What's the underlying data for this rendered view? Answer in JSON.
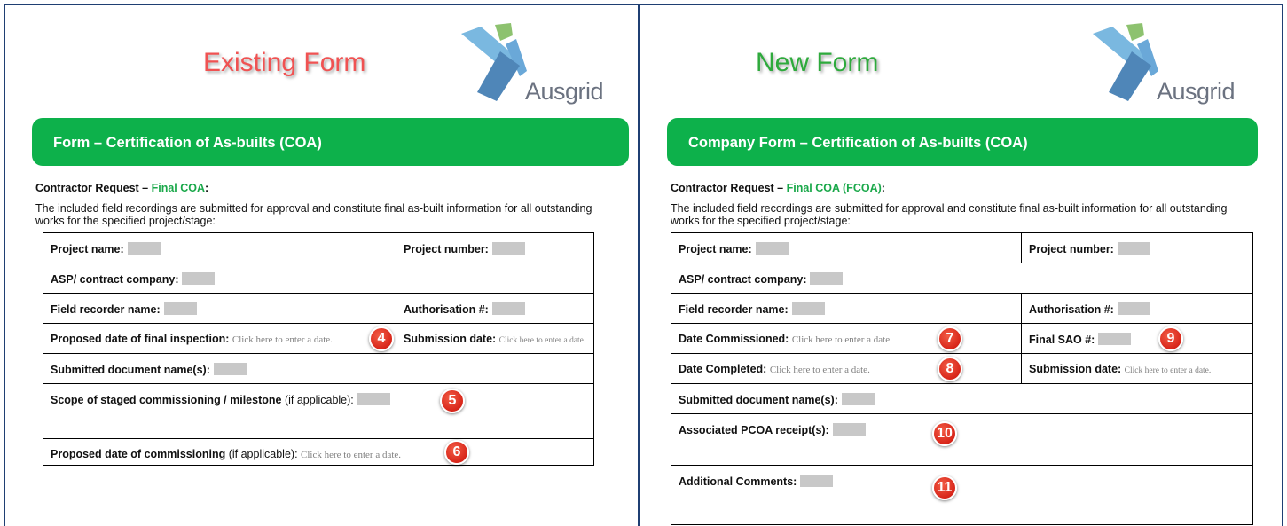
{
  "existing": {
    "heading": "Existing Form",
    "logo_text": "Ausgrid",
    "banner": "Form – Certification of As-builts (COA)",
    "request_prefix": "Contractor Request – ",
    "request_green": "Final COA",
    "request_suffix": ":",
    "intro": "The included field recordings are submitted for approval and constitute final as-built information for all outstanding works for the specified project/stage:",
    "project_name": "Project name:",
    "project_number": "Project number:",
    "asp": "ASP/ contract company:",
    "field_recorder": "Field recorder name:",
    "authorisation": "Authorisation #:",
    "proposed_final_inspection": "Proposed date of final inspection:",
    "date_placeholder": "Click here to enter a date.",
    "submission_date": "Submission date:",
    "submitted_docs": "Submitted document name(s):",
    "scope_bold": "Scope of staged commissioning / milestone",
    "scope_normal": " (if applicable):",
    "proposed_commissioning_bold": "Proposed date of commissioning",
    "proposed_commissioning_normal": " (if applicable):",
    "badges": [
      "4",
      "5",
      "6"
    ]
  },
  "new": {
    "heading": "New Form",
    "logo_text": "Ausgrid",
    "banner": "Company Form – Certification of As-builts (COA)",
    "request_prefix": "Contractor Request – ",
    "request_green": "Final COA (FCOA)",
    "request_suffix": ":",
    "intro": "The included field recordings are submitted for approval and constitute final as-built information for all outstanding works for the specified project/stage:",
    "project_name": "Project name:",
    "project_number": "Project number:",
    "asp": "ASP/ contract company:",
    "field_recorder": "Field recorder name:",
    "authorisation": "Authorisation #:",
    "date_commissioned": "Date Commissioned:",
    "date_placeholder": "Click here to enter a date.",
    "final_sao": "Final SAO #:",
    "date_completed": "Date Completed:",
    "submission_date": "Submission date:",
    "submitted_docs": "Submitted document name(s):",
    "pcoa": "Associated PCOA receipt(s):",
    "comments": "Additional Comments:",
    "badges": [
      "7",
      "9",
      "8",
      "10",
      "11"
    ]
  },
  "colors": {
    "frame": "#1f3f73",
    "banner_green": "#0db14b",
    "existing_heading": "#f05252",
    "new_heading": "#2eaa3c",
    "badge_red": "#d8261a",
    "field_placeholder": "#c8c8c8"
  }
}
